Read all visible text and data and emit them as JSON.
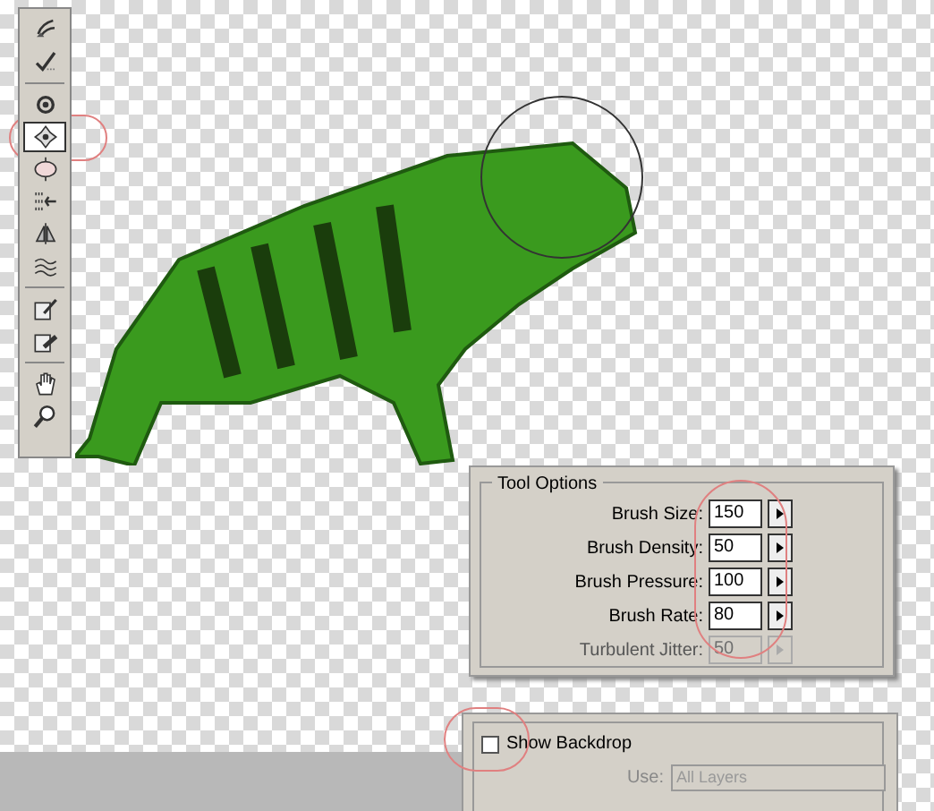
{
  "toolbar": {
    "tools": [
      {
        "kind": "warp",
        "selected": false
      },
      {
        "kind": "reconstruct",
        "selected": false
      },
      {
        "kind": "divider"
      },
      {
        "kind": "twirl",
        "selected": false
      },
      {
        "kind": "pucker",
        "selected": true
      },
      {
        "kind": "bloat",
        "selected": false
      },
      {
        "kind": "push",
        "selected": false
      },
      {
        "kind": "mirror",
        "selected": false
      },
      {
        "kind": "turbulence",
        "selected": false
      },
      {
        "kind": "divider"
      },
      {
        "kind": "freeze",
        "selected": false
      },
      {
        "kind": "thaw",
        "selected": false
      },
      {
        "kind": "divider"
      },
      {
        "kind": "hand",
        "selected": false
      },
      {
        "kind": "zoom",
        "selected": false
      }
    ]
  },
  "tool_options": {
    "title": "Tool Options",
    "fields": [
      {
        "label": "Brush Size:",
        "value": "150",
        "disabled": false
      },
      {
        "label": "Brush Density:",
        "value": "50",
        "disabled": false
      },
      {
        "label": "Brush Pressure:",
        "value": "100",
        "disabled": false
      },
      {
        "label": "Brush Rate:",
        "value": "80",
        "disabled": false
      },
      {
        "label": "Turbulent Jitter:",
        "value": "50",
        "disabled": true
      }
    ]
  },
  "backdrop": {
    "show_backdrop": {
      "label": "Show Backdrop",
      "checked": false
    },
    "use": {
      "label": "Use:",
      "value": "All Layers",
      "disabled": true
    }
  }
}
